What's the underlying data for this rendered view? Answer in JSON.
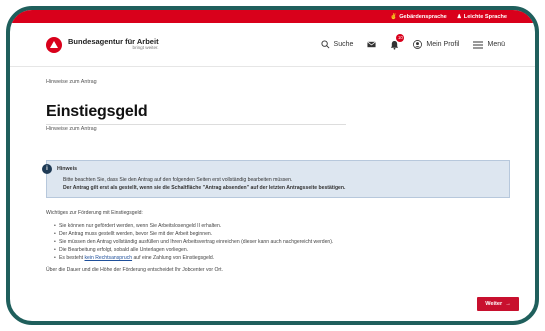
{
  "topbar": {
    "link1": "Gebärdensprache",
    "link2": "Leichte Sprache"
  },
  "header": {
    "logo_title": "Bundesagentur für Arbeit",
    "logo_sub": "bringt weiter.",
    "search": "Suche",
    "notification_count": "10",
    "profile": "Mein Profil",
    "menu": "Menü"
  },
  "breadcrumb": "Hinweise zum Antrag",
  "page": {
    "title": "Einstiegsgeld",
    "subtitle": "Hinweise zum Antrag"
  },
  "notice": {
    "title": "Hinweis",
    "line1": "Bitte beachten Sie, dass Sie den Antrag auf den folgenden Seiten erst vollständig bearbeiten müssen.",
    "line2": "Der Antrag gilt erst als gestellt, wenn sie die Schaltfläche \"Antrag absenden\" auf der letzten Antragsseite bestätigen."
  },
  "info": {
    "intro": "Wichtiges zur Förderung mit Einstiegsgeld:",
    "points": [
      "Sie können nur gefördert werden, wenn Sie Arbeitslosengeld II erhalten.",
      "Der Antrag muss gestellt werden, bevor Sie mit der Arbeit beginnen.",
      "Sie müssen den Antrag vollständig ausfüllen und Ihren Arbeitsvertrag einreichen (dieser kann auch nachgereicht werden).",
      "Die Bearbeitung erfolgt, sobald alle Unterlagen vorliegen."
    ],
    "last_point_pre": "Es besteht ",
    "last_point_link": "kein Rechtsanspruch",
    "last_point_post": " auf eine Zahlung von Einstiegsgeld.",
    "outro": "Über die Dauer und die Höhe der Förderung entscheidet Ihr Jobcenter vor Ort."
  },
  "button": {
    "next": "Weiter",
    "arrow": "→"
  },
  "colors": {
    "brand_red": "#d9001b",
    "frame": "#1f5f5c",
    "notice_bg": "#dde6f0"
  }
}
